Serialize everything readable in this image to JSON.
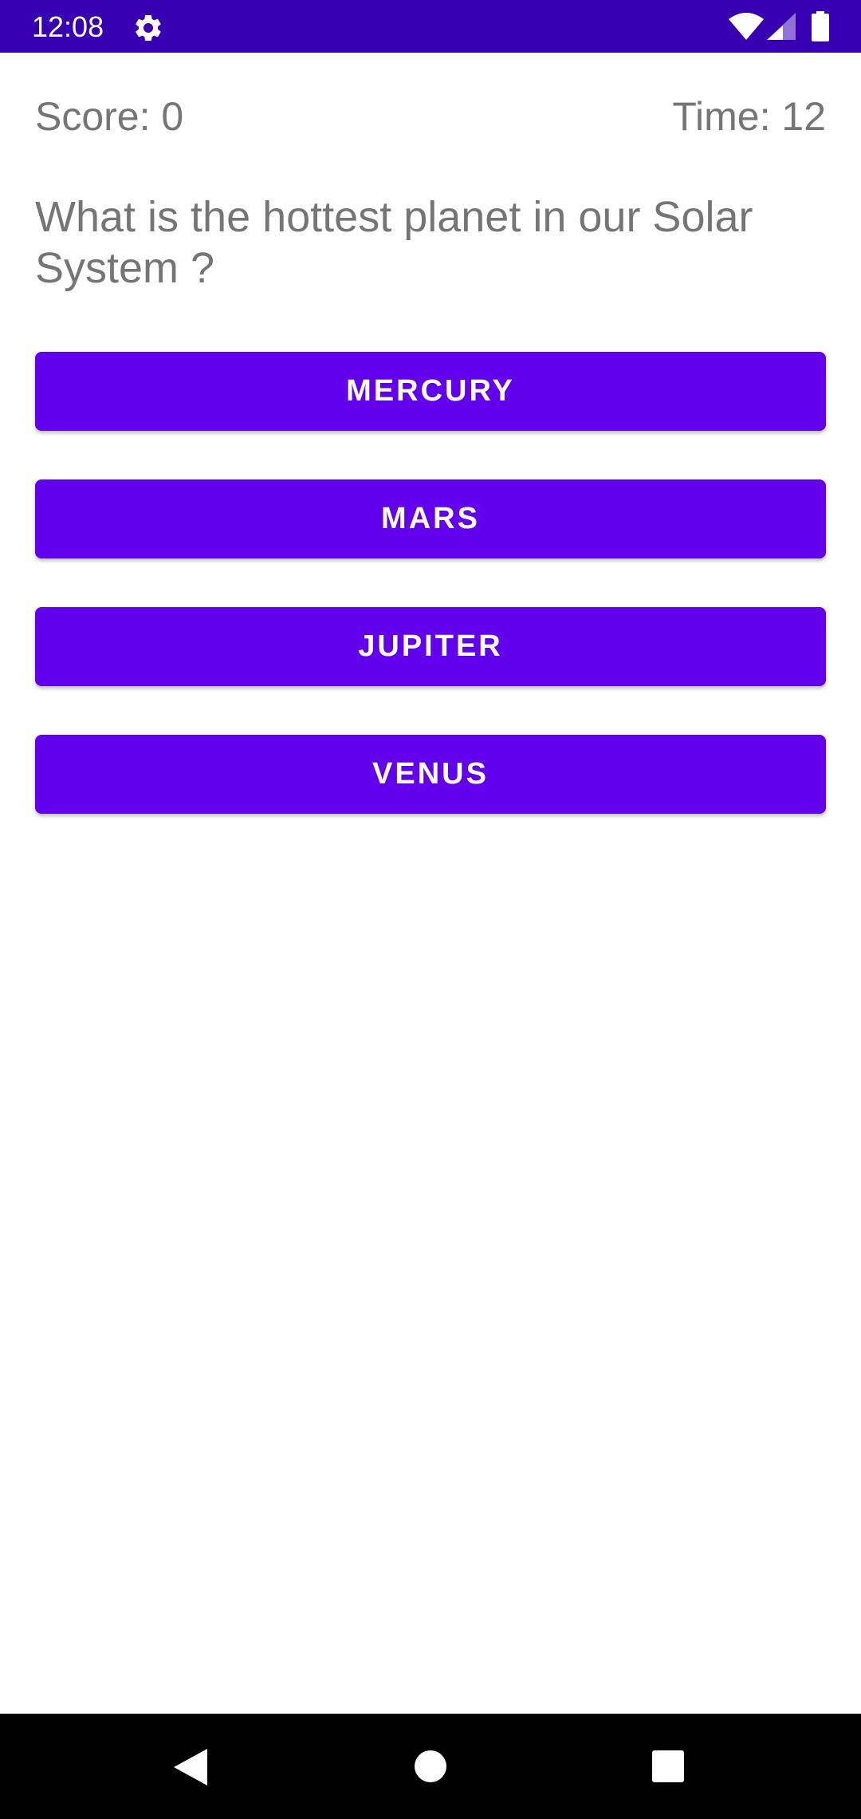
{
  "status_bar": {
    "time": "12:08",
    "icons": [
      "gear-icon",
      "wifi-icon",
      "signal-icon",
      "battery-icon"
    ],
    "background": "#3700b3"
  },
  "header": {
    "score_label": "Score: 0",
    "timer_label": "Time: 12"
  },
  "question": {
    "text": "What is the hottest planet in our Solar System ?"
  },
  "answers": [
    {
      "label": "MERCURY"
    },
    {
      "label": "MARS"
    },
    {
      "label": "JUPITER"
    },
    {
      "label": "VENUS"
    }
  ],
  "colors": {
    "button": "#6200ee",
    "text_secondary": "#757575"
  },
  "nav_bar": {
    "icons": [
      "back-icon",
      "home-icon",
      "recents-icon"
    ]
  }
}
